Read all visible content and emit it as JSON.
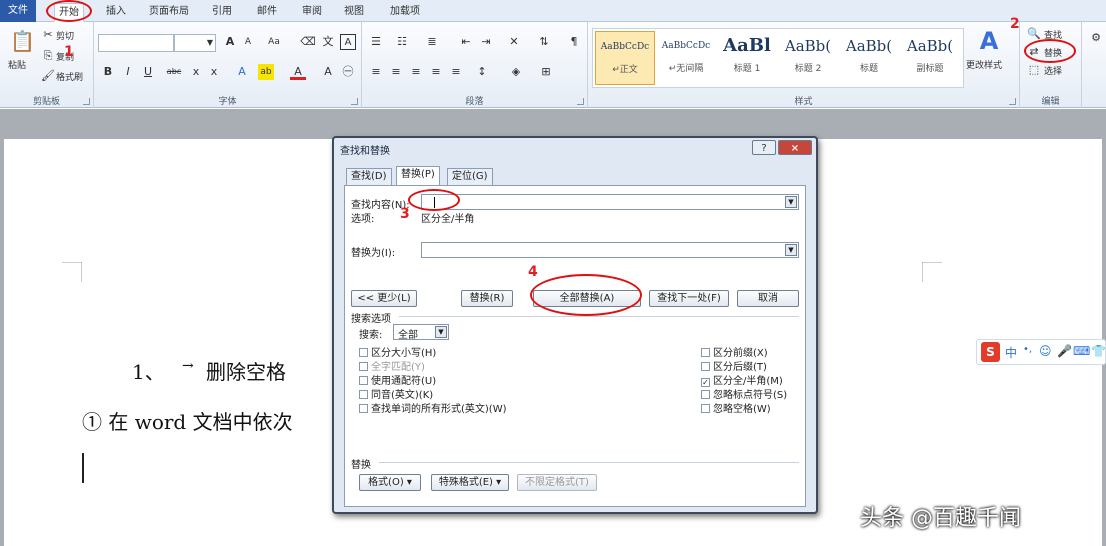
{
  "tabs": [
    "文件",
    "开始",
    "插入",
    "页面布局",
    "引用",
    "邮件",
    "审阅",
    "视图",
    "加载项"
  ],
  "clipboard": {
    "paste": "粘贴",
    "cut": "剪切",
    "copy": "复制",
    "painter": "格式刷",
    "label": "剪贴板"
  },
  "font": {
    "label": "字体",
    "grow": "A",
    "shrink": "A",
    "clear": "Aa",
    "bold": "B",
    "italic": "I",
    "underline": "U",
    "strike": "abc",
    "sub": "x",
    "sup": "x",
    "color": "A",
    "highlight": "ab"
  },
  "paragraph": {
    "label": "段落"
  },
  "styles": {
    "label": "样式",
    "items": [
      {
        "preview": "AaBbCcDc",
        "name": "↵正文"
      },
      {
        "preview": "AaBbCcDc",
        "name": "↵无间隔"
      },
      {
        "preview": "AaBl",
        "name": "标题 1"
      },
      {
        "preview": "AaBb(",
        "name": "标题 2"
      },
      {
        "preview": "AaBb(",
        "name": "标题"
      },
      {
        "preview": "AaBb(",
        "name": "副标题"
      }
    ],
    "change": "更改样式"
  },
  "editing": {
    "label": "编辑",
    "find": "查找",
    "replace": "替换",
    "select": "选择"
  },
  "annotations": {
    "n1": "1",
    "n2": "2",
    "n3": "3",
    "n4": "4"
  },
  "document": {
    "line1_num": "1、",
    "line1_arrow": "→",
    "line1_text": "删除空格",
    "line2": "① 在 word 文档中依次"
  },
  "ime": {
    "logo": "S",
    "cn": "中",
    "items": [
      "•,",
      "☺",
      "🎤",
      "⌨",
      "👕"
    ]
  },
  "watermark": "头条 @百趣千闻",
  "dialog": {
    "title": "查找和替换",
    "help": "?",
    "close": "×",
    "tabs": [
      "查找(D)",
      "替换(P)",
      "定位(G)"
    ],
    "find_label": "查找内容(N):",
    "find_value": "",
    "options_label": "选项:",
    "options_value": "区分全/半角",
    "replace_label": "替换为(I):",
    "replace_value": "",
    "btn_less": "<< 更少(L)",
    "btn_replace": "替换(R)",
    "btn_replace_all": "全部替换(A)",
    "btn_find_next": "查找下一处(F)",
    "btn_cancel": "取消",
    "search_options": "搜索选项",
    "search_label": "搜索:",
    "search_value": "全部",
    "left_checks": [
      "区分大小写(H)",
      "全字匹配(Y)",
      "使用通配符(U)",
      "同音(英文)(K)",
      "查找单词的所有形式(英文)(W)"
    ],
    "right_checks": [
      "区分前缀(X)",
      "区分后缀(T)",
      "区分全/半角(M)",
      "忽略标点符号(S)",
      "忽略空格(W)"
    ],
    "replace_section": "替换",
    "btn_format": "格式(O) ▾",
    "btn_special": "特殊格式(E) ▾",
    "btn_no_format": "不限定格式(T)"
  }
}
